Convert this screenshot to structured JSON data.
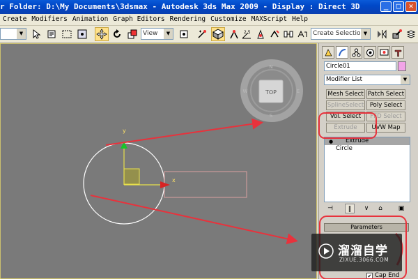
{
  "window": {
    "title": "r Folder: D:\\My Documents\\3dsmax    -  Autodesk 3ds Max  2009      -  Display : Direct 3D",
    "controls": [
      "_",
      "□",
      "✕"
    ]
  },
  "menu": [
    "Create",
    "Modifiers",
    "Animation",
    "Graph Editors",
    "Rendering",
    "Customize",
    "MAXScript",
    "Help"
  ],
  "toolbar": {
    "selection_filter": "",
    "ref_coord": "View",
    "named_selection_placeholder": "Create Selection Set",
    "snap_angle_label": "2.5"
  },
  "viewcube": {
    "face": "TOP",
    "compass": {
      "n": "N",
      "s": "S",
      "w": "W",
      "e": "E"
    }
  },
  "gizmo": {
    "x_label": "x",
    "y_label": "y"
  },
  "command_panel": {
    "object_name": "Circle01",
    "modifier_list": "Modifier List",
    "buttons": [
      {
        "id": "mesh-select",
        "label": "Mesh Select",
        "enabled": true
      },
      {
        "id": "patch-select",
        "label": "Patch Select",
        "enabled": true
      },
      {
        "id": "spline-select",
        "label": "SplineSelect",
        "enabled": false
      },
      {
        "id": "poly-select",
        "label": "Poly Select",
        "enabled": true
      },
      {
        "id": "vol-select",
        "label": "Vol. Select",
        "enabled": true
      },
      {
        "id": "fff-select",
        "label": "FFD Select",
        "enabled": false
      },
      {
        "id": "extrude",
        "label": "Extrude",
        "enabled": false
      },
      {
        "id": "uvw-map",
        "label": "UVW Map",
        "enabled": true
      }
    ],
    "stack": [
      {
        "label": "Extrude",
        "selected": true
      },
      {
        "label": "Circle",
        "selected": false
      }
    ],
    "rollout_title": "Parameters",
    "cap_end_label": "Cap End",
    "cap_end_checked": true
  },
  "watermark": {
    "main": "溜溜自学",
    "sub": "ZIXUE.3066.COM"
  },
  "colors": {
    "annotation": "#e8323c",
    "viewport_bg": "#7a7a7a",
    "object_color": "#f2a4e8"
  }
}
